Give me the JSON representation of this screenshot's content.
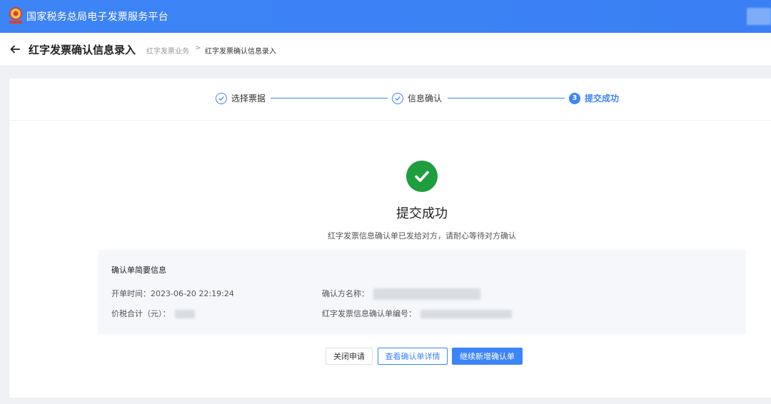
{
  "app": {
    "title": "国家税务总局电子发票服务平台"
  },
  "header": {
    "title": "红字发票确认信息录入",
    "breadcrumb": [
      "红字发票业务",
      "红字发票确认信息录入"
    ],
    "separator": ">"
  },
  "steps": [
    {
      "label": "选择票据",
      "state": "done"
    },
    {
      "label": "信息确认",
      "state": "done"
    },
    {
      "label": "提交成功",
      "state": "current",
      "number": "3"
    }
  ],
  "result": {
    "title": "提交成功",
    "message": "红字发票信息确认单已发给对方，请耐心等待对方确认"
  },
  "summary": {
    "title": "确认单简要信息",
    "fields": {
      "issue_time_label": "开单时间：",
      "issue_time_value": "2023-06-20 22:19:24",
      "total_label": "价税合计（元）：",
      "confirmer_label": "确认方名称：",
      "number_label": "红字发票信息确认单编号："
    }
  },
  "actions": {
    "close": "关闭申请",
    "view": "查看确认单详情",
    "continue": "继续新增确认单"
  },
  "colors": {
    "primary": "#3d84f7",
    "success": "#1e9e3e"
  }
}
